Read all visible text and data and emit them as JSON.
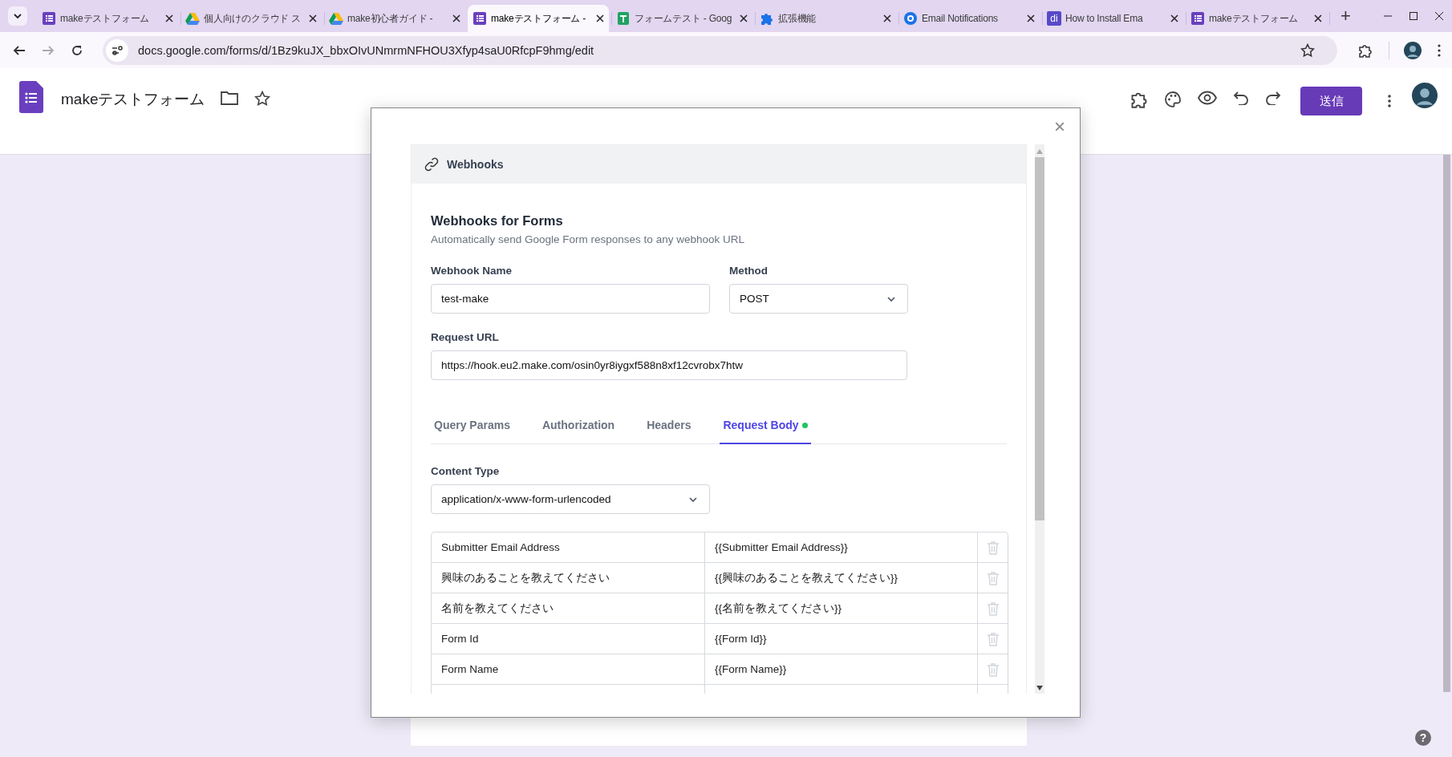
{
  "browser": {
    "tabs": [
      {
        "title": "makeテストフォーム",
        "kind": "forms",
        "selected": false
      },
      {
        "title": "個人向けのクラウド ス",
        "kind": "drive",
        "selected": false
      },
      {
        "title": "make初心者ガイド -",
        "kind": "drive",
        "selected": false
      },
      {
        "title": "makeテストフォーム -",
        "kind": "forms",
        "selected": true
      },
      {
        "title": "フォームテスト - Goog",
        "kind": "sheets",
        "selected": false
      },
      {
        "title": "拡張機能",
        "kind": "puzzle",
        "selected": false
      },
      {
        "title": "Email Notifications",
        "kind": "ring",
        "selected": false
      },
      {
        "title": "How to Install Ema",
        "kind": "letters",
        "icon_text": "di",
        "selected": false
      },
      {
        "title": "makeテストフォーム",
        "kind": "forms",
        "selected": false
      }
    ],
    "new_tab": "+",
    "address": "docs.google.com/forms/d/1Bz9kuJX_bbxOIvUNmrmNFHOU3Xfyp4saU0RfcpF9hmg/edit"
  },
  "app": {
    "title": "makeテストフォーム",
    "send_button": "送信"
  },
  "dialog": {
    "close": "×",
    "panel_title": "Webhooks",
    "heading": "Webhooks for Forms",
    "subheading": "Automatically send Google Form responses to any webhook URL",
    "name_label": "Webhook Name",
    "name_value": "test-make",
    "method_label": "Method",
    "method_value": "POST",
    "url_label": "Request URL",
    "url_value": "https://hook.eu2.make.com/osin0yr8iygxf588n8xf12cvrobx7htw",
    "tabs": [
      {
        "label": "Query Params",
        "selected": false,
        "dot": false
      },
      {
        "label": "Authorization",
        "selected": false,
        "dot": false
      },
      {
        "label": "Headers",
        "selected": false,
        "dot": false
      },
      {
        "label": "Request Body",
        "selected": true,
        "dot": true
      }
    ],
    "content_type_label": "Content Type",
    "content_type_value": "application/x-www-form-urlencoded",
    "body_rows": [
      {
        "key": "Submitter Email Address",
        "value": "{{Submitter Email Address}}"
      },
      {
        "key": "興味のあることを教えてください",
        "value": "{{興味のあることを教えてください}}"
      },
      {
        "key": "名前を教えてください",
        "value": "{{名前を教えてください}}"
      },
      {
        "key": "Form Id",
        "value": "{{Form Id}}"
      },
      {
        "key": "Form Name",
        "value": "{{Form Name}}"
      }
    ]
  },
  "help": "?"
}
